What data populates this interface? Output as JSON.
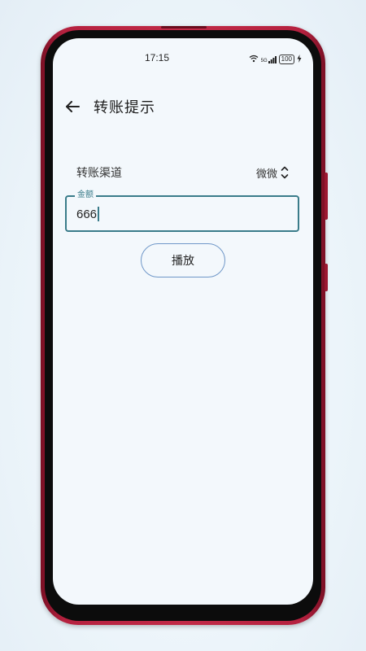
{
  "status_bar": {
    "time": "17:15",
    "network": "5G",
    "battery": "100"
  },
  "app_bar": {
    "title": "转账提示"
  },
  "form": {
    "channel_label": "转账渠道",
    "channel_value": "微微",
    "amount_label": "金额",
    "amount_value": "666"
  },
  "actions": {
    "play_label": "播放"
  },
  "colors": {
    "accent": "#3a7c8a",
    "button_border": "#6f97c8",
    "frame": "#c12a47",
    "screen_bg": "#f3f8fc"
  }
}
